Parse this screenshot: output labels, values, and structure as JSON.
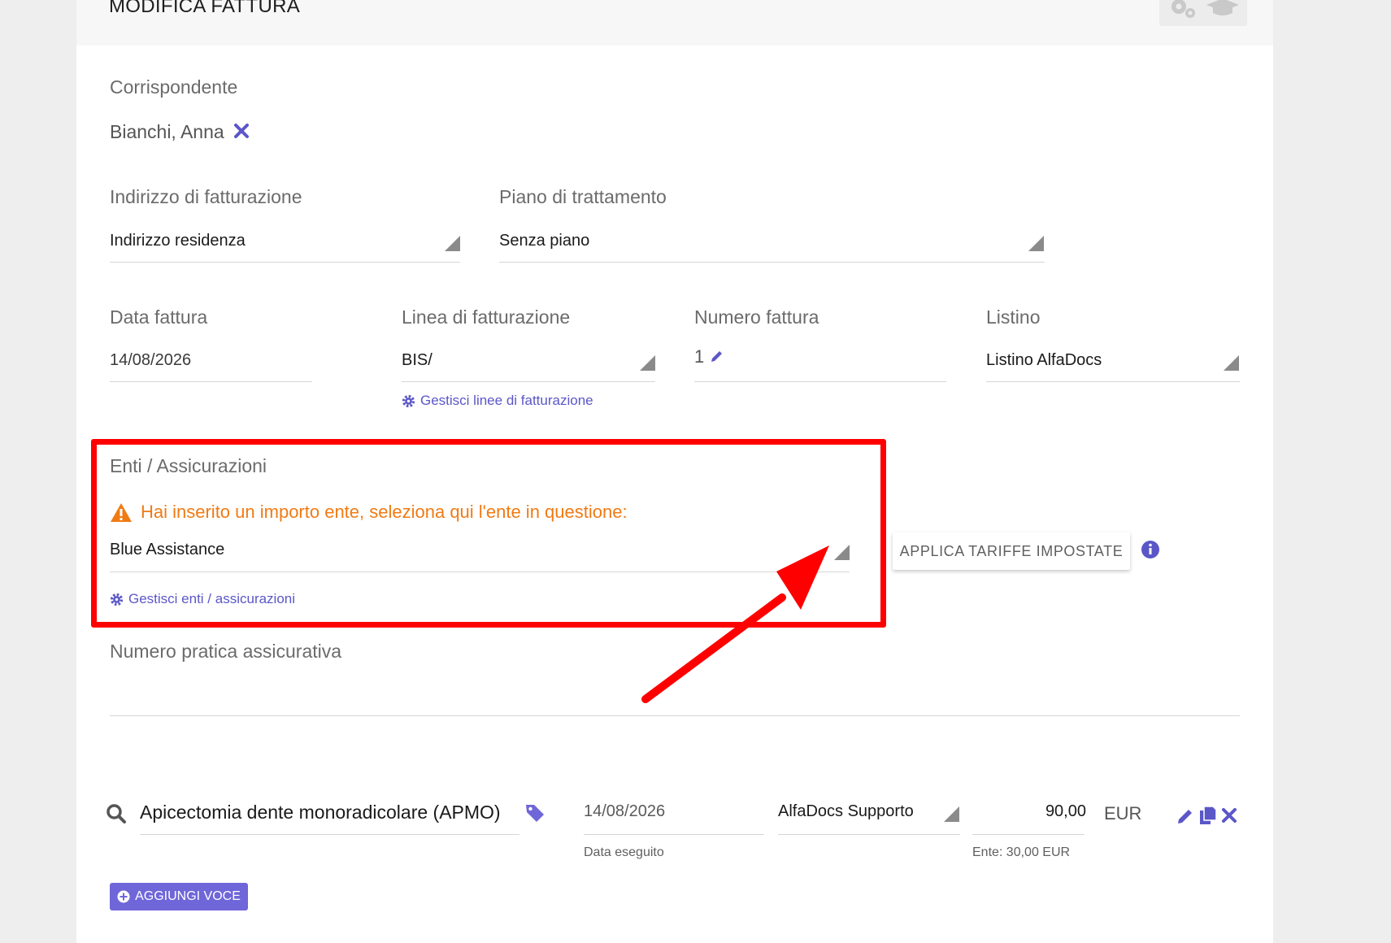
{
  "header": {
    "title": "MODIFICA FATTURA",
    "icons": [
      "gears-icon",
      "graduation-cap-icon"
    ]
  },
  "corrispondente": {
    "label": "Corrispondente",
    "value": "Bianchi, Anna"
  },
  "indirizzo": {
    "label": "Indirizzo di fatturazione",
    "value": "Indirizzo residenza"
  },
  "piano": {
    "label": "Piano di trattamento",
    "value": "Senza piano"
  },
  "data_fattura": {
    "label": "Data fattura",
    "value": "14/08/2026"
  },
  "linea": {
    "label": "Linea di fatturazione",
    "value": "BIS/",
    "manage_link": "Gestisci linee di fatturazione"
  },
  "numero": {
    "label": "Numero fattura",
    "value": "1"
  },
  "listino": {
    "label": "Listino",
    "value": "Listino AlfaDocs"
  },
  "enti": {
    "label": "Enti / Assicurazioni",
    "warning": "Hai inserito un importo ente, seleziona qui l'ente in questione:",
    "value": "Blue Assistance",
    "manage_link": "Gestisci enti / assicurazioni"
  },
  "apply_button": "APPLICA TARIFFE IMPOSTATE",
  "pratica": {
    "label": "Numero pratica assicurativa",
    "value": ""
  },
  "voce": {
    "description": "Apicectomia dente monoradicolare (APMO)",
    "date": "14/08/2026",
    "date_hint": "Data eseguito",
    "operator": "AlfaDocs Supporto",
    "amount": "90,00",
    "currency": "EUR",
    "ente_hint": "Ente: 30,00 EUR"
  },
  "add_button": "AGGIUNGI VOCE",
  "colors": {
    "accent": "#5b57c8",
    "warning": "#f07b14",
    "highlight": "#ff0000"
  }
}
